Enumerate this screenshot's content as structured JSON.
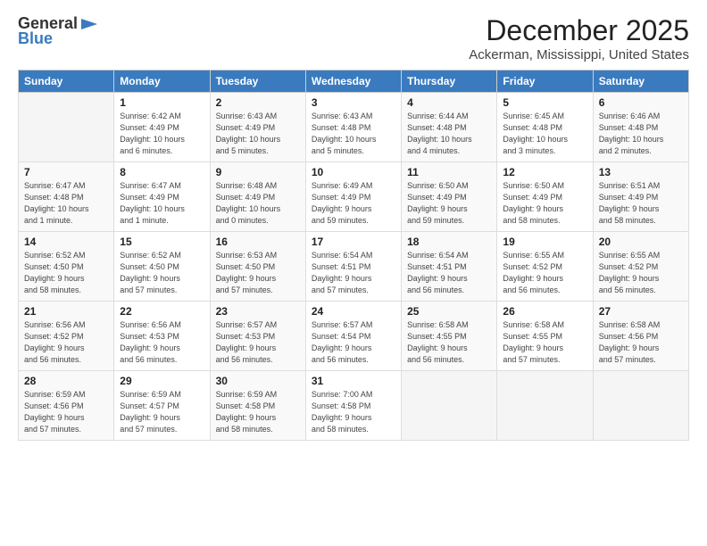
{
  "logo": {
    "general": "General",
    "blue": "Blue"
  },
  "header": {
    "title": "December 2025",
    "subtitle": "Ackerman, Mississippi, United States"
  },
  "weekdays": [
    "Sunday",
    "Monday",
    "Tuesday",
    "Wednesday",
    "Thursday",
    "Friday",
    "Saturday"
  ],
  "weeks": [
    [
      {
        "day": "",
        "info": ""
      },
      {
        "day": "1",
        "info": "Sunrise: 6:42 AM\nSunset: 4:49 PM\nDaylight: 10 hours\nand 6 minutes."
      },
      {
        "day": "2",
        "info": "Sunrise: 6:43 AM\nSunset: 4:49 PM\nDaylight: 10 hours\nand 5 minutes."
      },
      {
        "day": "3",
        "info": "Sunrise: 6:43 AM\nSunset: 4:48 PM\nDaylight: 10 hours\nand 5 minutes."
      },
      {
        "day": "4",
        "info": "Sunrise: 6:44 AM\nSunset: 4:48 PM\nDaylight: 10 hours\nand 4 minutes."
      },
      {
        "day": "5",
        "info": "Sunrise: 6:45 AM\nSunset: 4:48 PM\nDaylight: 10 hours\nand 3 minutes."
      },
      {
        "day": "6",
        "info": "Sunrise: 6:46 AM\nSunset: 4:48 PM\nDaylight: 10 hours\nand 2 minutes."
      }
    ],
    [
      {
        "day": "7",
        "info": "Sunrise: 6:47 AM\nSunset: 4:48 PM\nDaylight: 10 hours\nand 1 minute."
      },
      {
        "day": "8",
        "info": "Sunrise: 6:47 AM\nSunset: 4:49 PM\nDaylight: 10 hours\nand 1 minute."
      },
      {
        "day": "9",
        "info": "Sunrise: 6:48 AM\nSunset: 4:49 PM\nDaylight: 10 hours\nand 0 minutes."
      },
      {
        "day": "10",
        "info": "Sunrise: 6:49 AM\nSunset: 4:49 PM\nDaylight: 9 hours\nand 59 minutes."
      },
      {
        "day": "11",
        "info": "Sunrise: 6:50 AM\nSunset: 4:49 PM\nDaylight: 9 hours\nand 59 minutes."
      },
      {
        "day": "12",
        "info": "Sunrise: 6:50 AM\nSunset: 4:49 PM\nDaylight: 9 hours\nand 58 minutes."
      },
      {
        "day": "13",
        "info": "Sunrise: 6:51 AM\nSunset: 4:49 PM\nDaylight: 9 hours\nand 58 minutes."
      }
    ],
    [
      {
        "day": "14",
        "info": "Sunrise: 6:52 AM\nSunset: 4:50 PM\nDaylight: 9 hours\nand 58 minutes."
      },
      {
        "day": "15",
        "info": "Sunrise: 6:52 AM\nSunset: 4:50 PM\nDaylight: 9 hours\nand 57 minutes."
      },
      {
        "day": "16",
        "info": "Sunrise: 6:53 AM\nSunset: 4:50 PM\nDaylight: 9 hours\nand 57 minutes."
      },
      {
        "day": "17",
        "info": "Sunrise: 6:54 AM\nSunset: 4:51 PM\nDaylight: 9 hours\nand 57 minutes."
      },
      {
        "day": "18",
        "info": "Sunrise: 6:54 AM\nSunset: 4:51 PM\nDaylight: 9 hours\nand 56 minutes."
      },
      {
        "day": "19",
        "info": "Sunrise: 6:55 AM\nSunset: 4:52 PM\nDaylight: 9 hours\nand 56 minutes."
      },
      {
        "day": "20",
        "info": "Sunrise: 6:55 AM\nSunset: 4:52 PM\nDaylight: 9 hours\nand 56 minutes."
      }
    ],
    [
      {
        "day": "21",
        "info": "Sunrise: 6:56 AM\nSunset: 4:52 PM\nDaylight: 9 hours\nand 56 minutes."
      },
      {
        "day": "22",
        "info": "Sunrise: 6:56 AM\nSunset: 4:53 PM\nDaylight: 9 hours\nand 56 minutes."
      },
      {
        "day": "23",
        "info": "Sunrise: 6:57 AM\nSunset: 4:53 PM\nDaylight: 9 hours\nand 56 minutes."
      },
      {
        "day": "24",
        "info": "Sunrise: 6:57 AM\nSunset: 4:54 PM\nDaylight: 9 hours\nand 56 minutes."
      },
      {
        "day": "25",
        "info": "Sunrise: 6:58 AM\nSunset: 4:55 PM\nDaylight: 9 hours\nand 56 minutes."
      },
      {
        "day": "26",
        "info": "Sunrise: 6:58 AM\nSunset: 4:55 PM\nDaylight: 9 hours\nand 57 minutes."
      },
      {
        "day": "27",
        "info": "Sunrise: 6:58 AM\nSunset: 4:56 PM\nDaylight: 9 hours\nand 57 minutes."
      }
    ],
    [
      {
        "day": "28",
        "info": "Sunrise: 6:59 AM\nSunset: 4:56 PM\nDaylight: 9 hours\nand 57 minutes."
      },
      {
        "day": "29",
        "info": "Sunrise: 6:59 AM\nSunset: 4:57 PM\nDaylight: 9 hours\nand 57 minutes."
      },
      {
        "day": "30",
        "info": "Sunrise: 6:59 AM\nSunset: 4:58 PM\nDaylight: 9 hours\nand 58 minutes."
      },
      {
        "day": "31",
        "info": "Sunrise: 7:00 AM\nSunset: 4:58 PM\nDaylight: 9 hours\nand 58 minutes."
      },
      {
        "day": "",
        "info": ""
      },
      {
        "day": "",
        "info": ""
      },
      {
        "day": "",
        "info": ""
      }
    ]
  ]
}
